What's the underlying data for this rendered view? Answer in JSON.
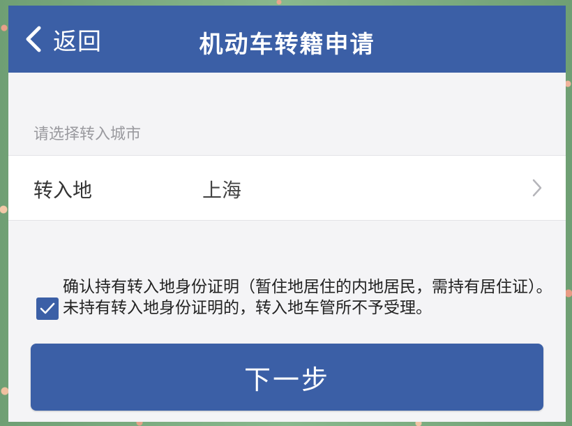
{
  "header": {
    "back_label": "返回",
    "title": "机动车转籍申请"
  },
  "form": {
    "section_label": "请选择转入城市",
    "destination_label": "转入地",
    "destination_value": "上海"
  },
  "agreement": {
    "checked": true,
    "text": "确认持有转入地身份证明（暂住地居住的内地居民，需持有居住证）。未持有转入地身份证明的，转入地车管所不予受理。"
  },
  "actions": {
    "next_label": "下一步"
  },
  "colors": {
    "primary": "#3b5fa6",
    "background": "#f4f4f6",
    "muted_text": "#9a9a9f"
  },
  "icons": {
    "back": "chevron-left-icon",
    "row_arrow": "chevron-right-icon",
    "checkbox": "check-icon"
  }
}
